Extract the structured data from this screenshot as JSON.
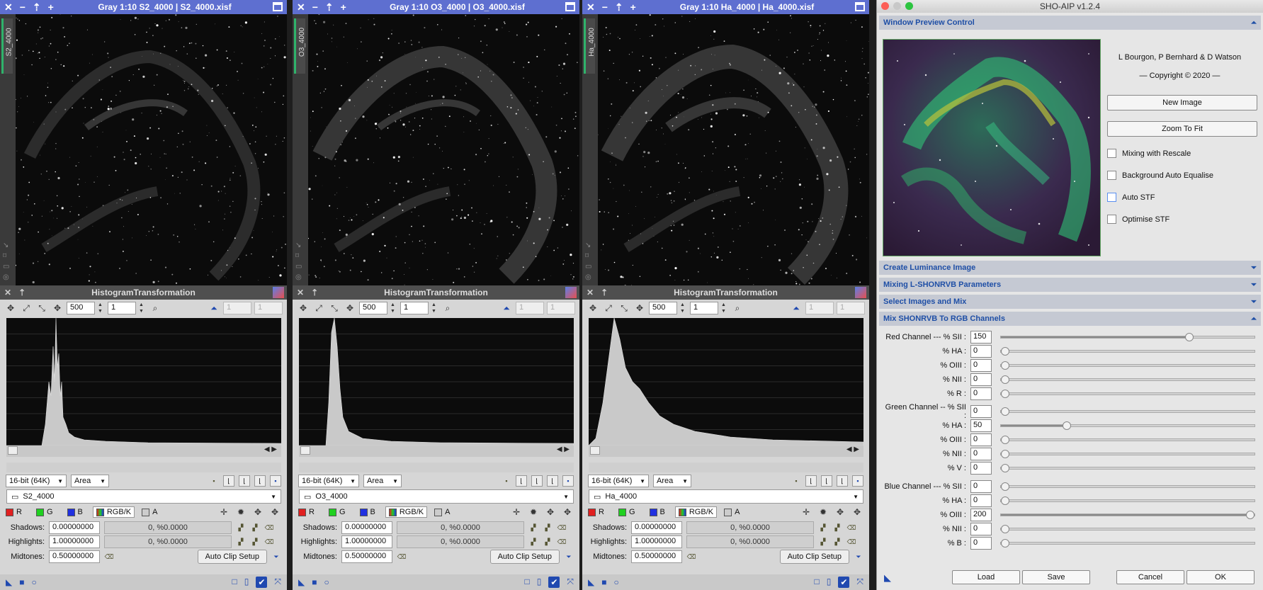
{
  "windows": [
    {
      "title": "Gray 1:10 S2_4000 | S2_4000.xisf",
      "tab": "S2_4000",
      "histo_title": "HistogramTransformation",
      "zoom_value": "500",
      "zoom_step": "1",
      "disabled_a": "1",
      "disabled_b": "1",
      "bitdepth": "16-bit (64K)",
      "mode": "Area",
      "view": "S2_4000",
      "channels": {
        "r": "R",
        "g": "G",
        "b": "B",
        "rgbk": "RGB/K",
        "a": "A"
      },
      "shadows_label": "Shadows:",
      "shadows": "0.00000000",
      "shadows_stat": "0, %0.0000",
      "highlights_label": "Highlights:",
      "highlights": "1.00000000",
      "highlights_stat": "0, %0.0000",
      "midtones_label": "Midtones:",
      "midtones": "0.50000000",
      "auto_clip": "Auto Clip Setup",
      "histogram_shape": "spiky"
    },
    {
      "title": "Gray 1:10 O3_4000 | O3_4000.xisf",
      "tab": "O3_4000",
      "histo_title": "HistogramTransformation",
      "zoom_value": "500",
      "zoom_step": "1",
      "disabled_a": "1",
      "disabled_b": "1",
      "bitdepth": "16-bit (64K)",
      "mode": "Area",
      "view": "O3_4000",
      "channels": {
        "r": "R",
        "g": "G",
        "b": "B",
        "rgbk": "RGB/K",
        "a": "A"
      },
      "shadows_label": "Shadows:",
      "shadows": "0.00000000",
      "shadows_stat": "0, %0.0000",
      "highlights_label": "Highlights:",
      "highlights": "1.00000000",
      "highlights_stat": "0, %0.0000",
      "midtones_label": "Midtones:",
      "midtones": "0.50000000",
      "auto_clip": "Auto Clip Setup",
      "histogram_shape": "narrow"
    },
    {
      "title": "Gray 1:10 Ha_4000 | Ha_4000.xisf",
      "tab": "Ha_4000",
      "histo_title": "HistogramTransformation",
      "zoom_value": "500",
      "zoom_step": "1",
      "disabled_a": "1",
      "disabled_b": "1",
      "bitdepth": "16-bit (64K)",
      "mode": "Area",
      "view": "Ha_4000",
      "channels": {
        "r": "R",
        "g": "G",
        "b": "B",
        "rgbk": "RGB/K",
        "a": "A"
      },
      "shadows_label": "Shadows:",
      "shadows": "0.00000000",
      "shadows_stat": "0, %0.0000",
      "highlights_label": "Highlights:",
      "highlights": "1.00000000",
      "highlights_stat": "0, %0.0000",
      "midtones_label": "Midtones:",
      "midtones": "0.50000000",
      "auto_clip": "Auto Clip Setup",
      "histogram_shape": "wide"
    }
  ],
  "sho": {
    "title": "SHO-AIP v1.2.4",
    "sections": {
      "preview": "Window Preview Control",
      "lum": "Create Luminance Image",
      "mixing": "Mixing L-SHONRVB Parameters",
      "select": "Select Images and Mix",
      "mix": "Mix SHONRVB To RGB Channels"
    },
    "credits": "L Bourgon, P Bernhard & D Watson",
    "copyright": "— Copyright © 2020 —",
    "new_image": "New Image",
    "zoom_fit": "Zoom To Fit",
    "checks": [
      {
        "label": "Mixing with Rescale",
        "checked": false
      },
      {
        "label": "Background Auto Equalise",
        "checked": false
      },
      {
        "label": "Auto STF",
        "checked": false
      },
      {
        "label": "Optimise STF",
        "checked": false
      }
    ],
    "red": [
      {
        "label": "Red Channel --- % SII :",
        "value": "150"
      },
      {
        "label": "% HA :",
        "value": "0"
      },
      {
        "label": "% OIII :",
        "value": "0"
      },
      {
        "label": "% NII :",
        "value": "0"
      },
      {
        "label": "% R :",
        "value": "0"
      }
    ],
    "green": [
      {
        "label": "Green Channel -- % SII :",
        "value": "0"
      },
      {
        "label": "% HA :",
        "value": "50"
      },
      {
        "label": "% OIII :",
        "value": "0"
      },
      {
        "label": "% NII :",
        "value": "0"
      },
      {
        "label": "% V :",
        "value": "0"
      }
    ],
    "blue": [
      {
        "label": "Blue Channel --- % SII :",
        "value": "0"
      },
      {
        "label": "% HA :",
        "value": "0"
      },
      {
        "label": "% OIII :",
        "value": "200"
      },
      {
        "label": "% NII :",
        "value": "0"
      },
      {
        "label": "% B :",
        "value": "0"
      }
    ],
    "buttons": {
      "load": "Load",
      "save": "Save",
      "cancel": "Cancel",
      "ok": "OK"
    }
  },
  "colors": {
    "title_bar": "#5e6fd0",
    "section_text": "#1f4fa6",
    "accent_green": "#2fb36b"
  }
}
